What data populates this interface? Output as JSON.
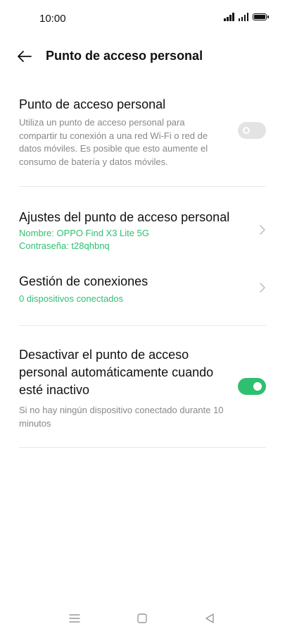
{
  "status": {
    "time": "10:00"
  },
  "header": {
    "title": "Punto de acceso personal"
  },
  "hotspot": {
    "title": "Punto de acceso personal",
    "description": "Utiliza un punto de acceso personal para compartir tu conexión a una red Wi-Fi o red de datos móviles. Es posible que esto aumente el consumo de batería y datos móviles.",
    "enabled": false
  },
  "settings": {
    "title": "Ajustes del punto de acceso personal",
    "name_line": "Nombre: OPPO Find X3 Lite 5G",
    "password_line": "Contraseña: t28qhbnq"
  },
  "connections": {
    "title": "Gestión de conexiones",
    "status": "0 dispositivos conectados"
  },
  "auto_off": {
    "title": "Desactivar el punto de acceso personal automáticamente cuando esté inactivo",
    "description": "Si no hay ningún dispositivo conectado durante 10 minutos",
    "enabled": true
  },
  "colors": {
    "accent": "#2fbf71",
    "toggle_off": "#e3e3e3"
  }
}
